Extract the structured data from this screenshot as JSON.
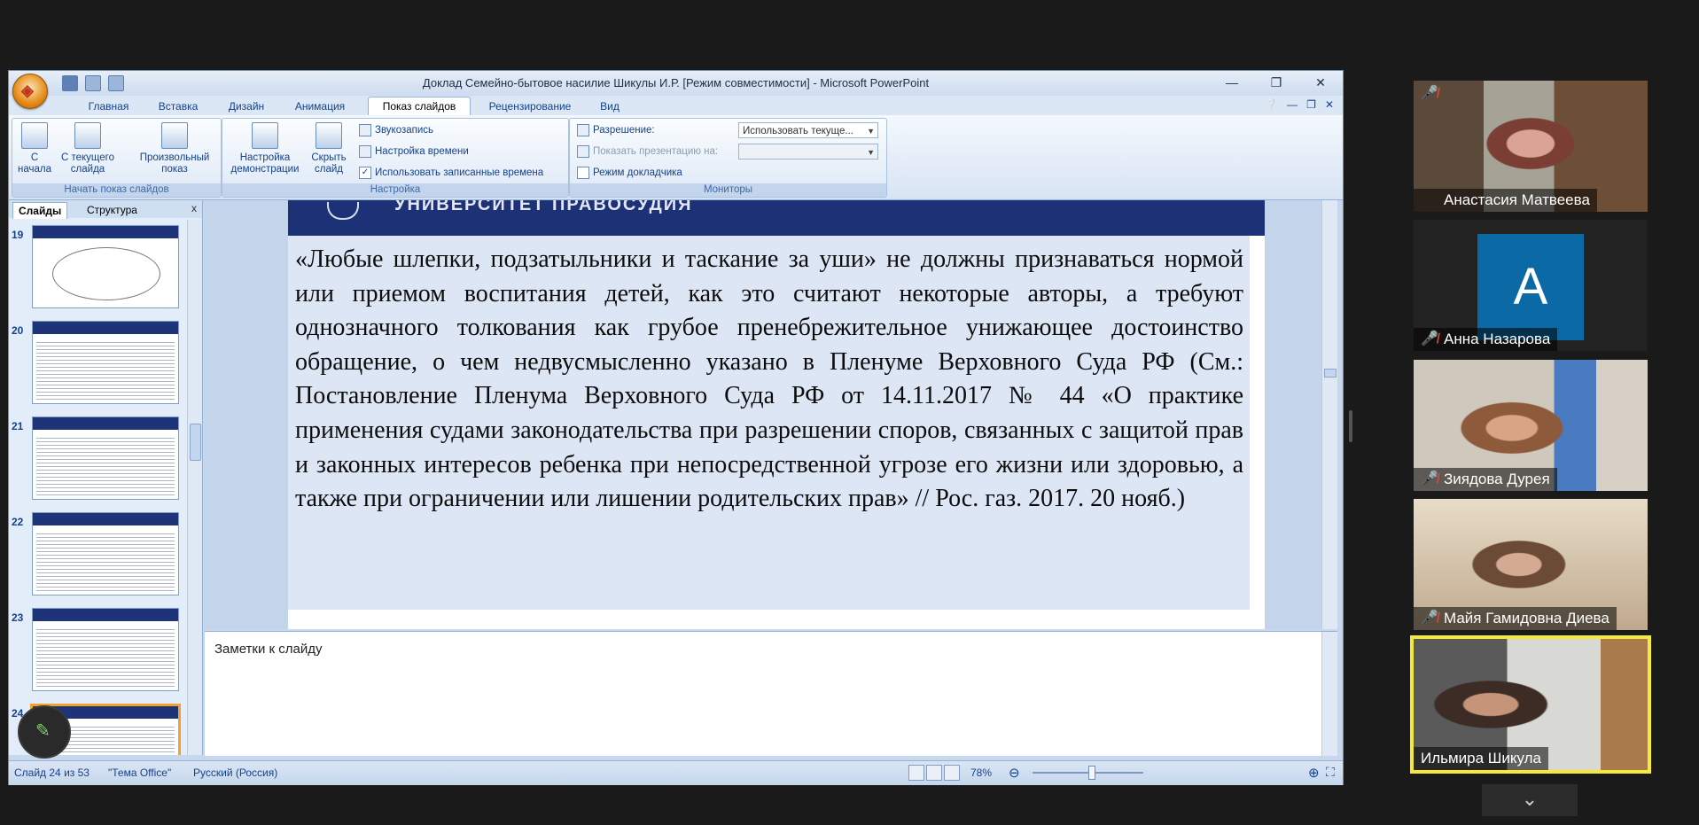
{
  "window": {
    "title": "Доклад  Семейно-бытовое насилие Шикулы И.Р. [Режим совместимости] - Microsoft PowerPoint",
    "min": "—",
    "max": "❐",
    "close": "✕"
  },
  "ribbon_tabs": [
    {
      "label": "Главная"
    },
    {
      "label": "Вставка"
    },
    {
      "label": "Дизайн"
    },
    {
      "label": "Анимация"
    },
    {
      "label": "Показ слайдов"
    },
    {
      "label": "Рецензирование"
    },
    {
      "label": "Вид"
    }
  ],
  "ribbon": {
    "from_start": "С начала",
    "from_current": "С текущего слайда",
    "custom_show": "Произвольный показ",
    "group_start": "Начать показ слайдов",
    "setup_show": "Настройка демонстрации",
    "hide_slide": "Скрыть слайд",
    "record_narration": "Звукозапись",
    "rehearse_timings": "Настройка времени",
    "use_timings": "Использовать записанные времена",
    "group_setup": "Настройка",
    "resolution_label": "Разрешение:",
    "resolution_value": "Использовать текуще...",
    "show_on_label": "Показать презентацию на:",
    "presenter_view": "Режим докладчика",
    "group_monitors": "Мониторы"
  },
  "left_pane": {
    "tab_slides": "Слайды",
    "tab_outline": "Структура",
    "close": "x",
    "slide_numbers": [
      "19",
      "20",
      "21",
      "22",
      "23",
      "24"
    ]
  },
  "slide": {
    "header_text": "УНИВЕРСИТЕТ ПРАВОСУДИЯ",
    "body": "«Любые шлепки, подзатыльники и таскание за уши» не должны признаваться нормой или приемом воспитания детей, как это считают некоторые авторы, а требуют однозначного толкования как грубое пренебрежительное унижающее достоинство обращение, о чем недвусмысленно указано в Пленуме Верховного Суда РФ (См.: Постановление Пленума Верховного Суда РФ от 14.11.2017 № 44 «О практике применения судами законодательства при разрешении споров, связанных с защитой прав и законных интересов ребенка при непосредственной угрозе его жизни или здоровью, а также при ограничении или лишении родительских прав» // Рос. газ. 2017. 20 нояб.)"
  },
  "notes": {
    "placeholder": "Заметки к слайду"
  },
  "status": {
    "slide_position": "Слайд 24 из 53",
    "theme": "\"Тема Office\"",
    "language": "Русский (Россия)",
    "zoom": "78%"
  },
  "participants": [
    {
      "name": "Анастасия Матвеева",
      "muted": true
    },
    {
      "name": "Анна Назарова",
      "muted": true,
      "avatar_letter": "А"
    },
    {
      "name": "Зиядова Дурея",
      "muted": true
    },
    {
      "name": "Майя Гамидовна Диева",
      "muted": true
    },
    {
      "name": "Ильмира Шикула",
      "muted": false,
      "active_speaker": true
    }
  ],
  "colors": {
    "active_speaker_border": "#f3ea3b",
    "slide_band": "#1d3276",
    "avatar_bg": "#0b6aa6"
  }
}
